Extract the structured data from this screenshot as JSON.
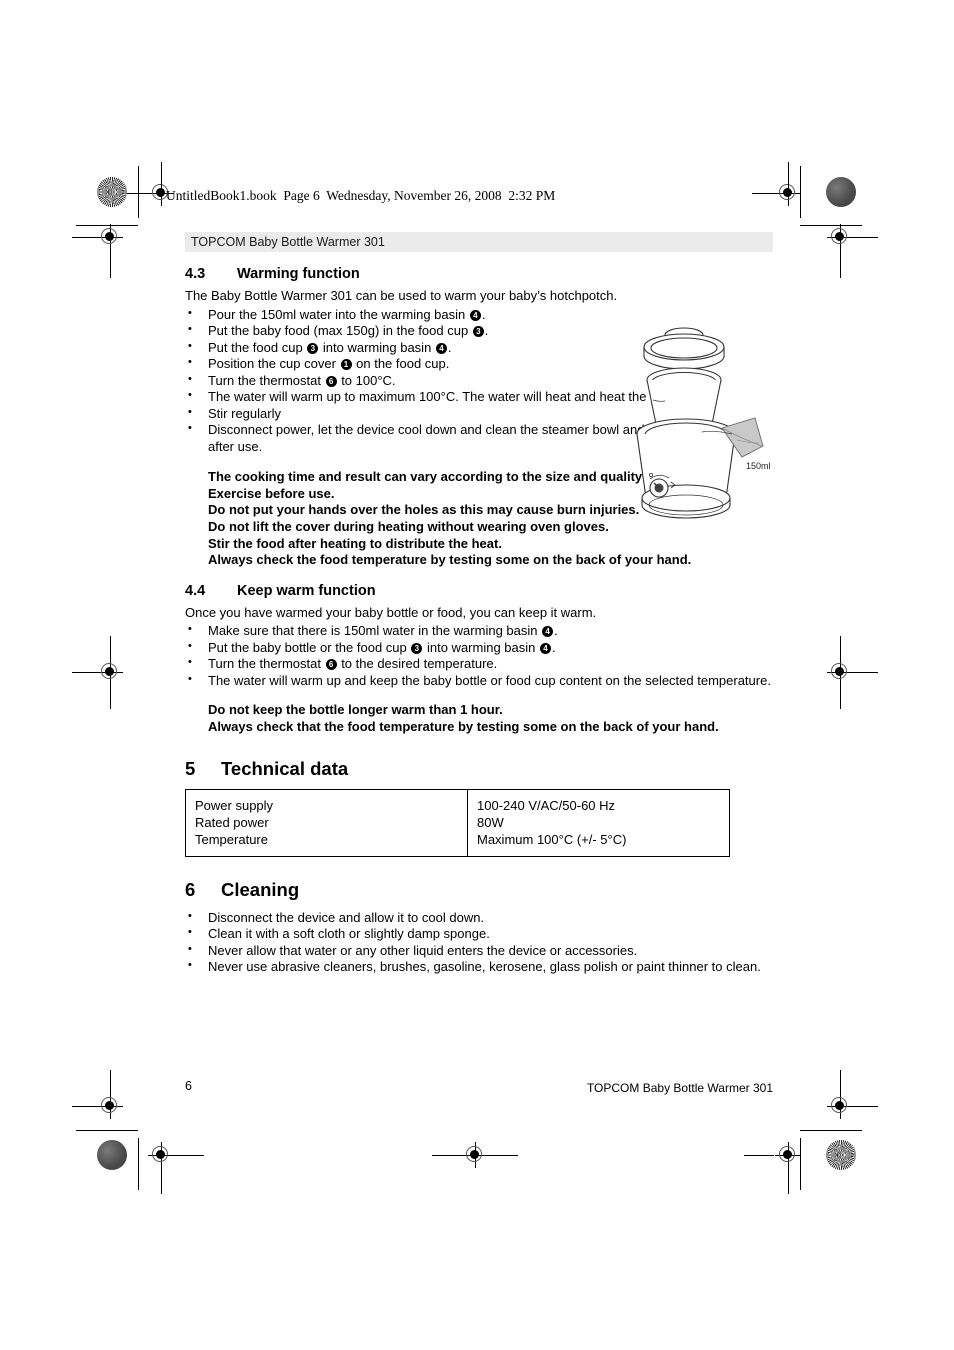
{
  "document": {
    "book_line": "UntitledBook1.book  Page 6  Wednesday, November 26, 2008  2:32 PM",
    "banner_title": "TOPCOM Baby Bottle Warmer 301",
    "footer_page_number": "6",
    "footer_title": "TOPCOM Baby Bottle Warmer 301"
  },
  "section_43": {
    "number": "4.3",
    "title": "Warming function",
    "intro": "The Baby Bottle Warmer 301 can be used to warm your baby’s hotchpotch.",
    "bullets": [
      {
        "pre": "Pour the 150ml water into the warming basin ",
        "ref": "4",
        "post": "."
      },
      {
        "pre": "Put the baby food (max 150g) in the food cup ",
        "ref": "3",
        "post": "."
      },
      {
        "pre": "Put the food cup ",
        "ref": "3",
        "mid": " into warming basin ",
        "ref2": "4",
        "post": "."
      },
      {
        "pre": "Position the cup cover ",
        "ref": "1",
        "post": " on the food cup."
      },
      {
        "pre": "Turn the thermostat ",
        "ref": "6",
        "post": " to 100°C."
      },
      {
        "pre": "The water will warm up to maximum 100°C. The water will heat and heat the food."
      },
      {
        "pre": "Stir regularly"
      },
      {
        "pre": "Disconnect power, let the device cool down and clean the steamer bowl and cover immediately after use."
      }
    ],
    "notes": [
      "The cooking time and result can vary according to the size and quality of the food. Exercise before use.",
      "Do not put your hands over the holes as this may cause burn injuries.",
      "Do not lift the cover during heating without wearing oven gloves.",
      "Stir the food after heating to distribute the heat.",
      "Always check the food temperature by testing some on the back of your hand."
    ]
  },
  "section_44": {
    "number": "4.4",
    "title": "Keep warm function",
    "intro": "Once you have warmed your baby bottle or food, you can keep it warm.",
    "bullets": [
      {
        "pre": "Make sure that there is 150ml water in the warming basin ",
        "ref": "4",
        "post": "."
      },
      {
        "pre": "Put the baby bottle or the food cup ",
        "ref": "3",
        "mid": " into warming basin ",
        "ref2": "4",
        "post": "."
      },
      {
        "pre": "Turn the thermostat ",
        "ref": "6",
        "post": " to the desired temperature."
      },
      {
        "pre": "The water will warm up and keep the baby bottle or food cup content on the selected temperature."
      }
    ],
    "notes": [
      "Do not keep the bottle longer warm than 1 hour.",
      "Always check that the food temperature by testing some on the back of your hand."
    ]
  },
  "section_5": {
    "number": "5",
    "title": "Technical data",
    "rows": [
      {
        "label": "Power supply",
        "value": "100-240 V/AC/50-60 Hz"
      },
      {
        "label": "Rated power",
        "value": "80W"
      },
      {
        "label": "Temperature",
        "value": "Maximum 100°C (+/- 5°C)"
      }
    ]
  },
  "section_6": {
    "number": "6",
    "title": "Cleaning",
    "bullets": [
      "Disconnect the device and allow it to cool down.",
      "Clean it with a soft cloth or slightly damp sponge.",
      "Never allow that water or any other liquid enters the device or accessories.",
      "Never use abrasive cleaners, brushes, gasoline, kerosene, glass polish or paint thinner to clean."
    ]
  },
  "illustration": {
    "name": "baby-bottle-warmer-exploded-view",
    "measure_label": "150ml",
    "parts": [
      "cup cover",
      "food cup",
      "warming basin",
      "thermostat dial",
      "measuring spout"
    ]
  },
  "colors": {
    "banner_background": "#ebebeb",
    "text": "#000000",
    "spout_fill": "#c9c9c9"
  }
}
